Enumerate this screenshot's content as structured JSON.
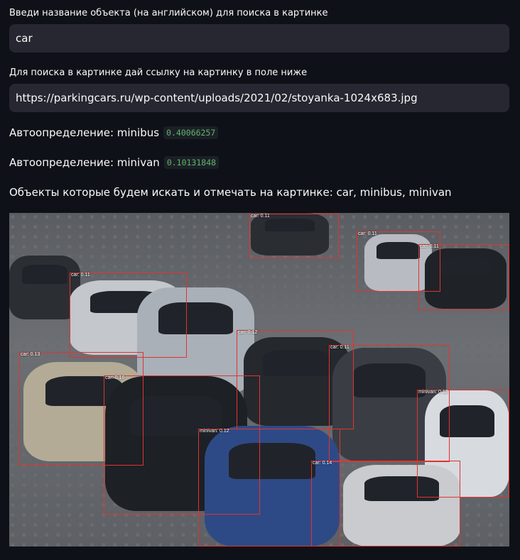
{
  "object_query": {
    "label": "Введи название объекта (на английском) для поиска в картинке",
    "value": "car"
  },
  "image_url": {
    "label": "Для поиска в картинке дай ссылку на картинку в поле ниже",
    "value": "https://parkingcars.ru/wp-content/uploads/2021/02/stoyanka-1024x683.jpg"
  },
  "detections": [
    {
      "label": "Автоопределение: minibus",
      "score": "0.40066257"
    },
    {
      "label": "Автоопределение: minivan",
      "score": "0.10131848"
    }
  ],
  "summary": "Объекты которые будем искать и отмечать на картинке: car, minibus, minivan",
  "image": {
    "box_color": "#e03434",
    "boxes": [
      {
        "label": "car: 0.11"
      },
      {
        "label": "car: 0.11"
      },
      {
        "label": "car: 0.11"
      },
      {
        "label": "car: 0.11"
      },
      {
        "label": "car: 0.12"
      },
      {
        "label": "car: 0.13"
      },
      {
        "label": "car: 0.16"
      },
      {
        "label": "car: 0.11"
      },
      {
        "label": "minivan: 0.12"
      },
      {
        "label": "minivan: 0.12"
      },
      {
        "label": "car: 0.14"
      }
    ]
  }
}
